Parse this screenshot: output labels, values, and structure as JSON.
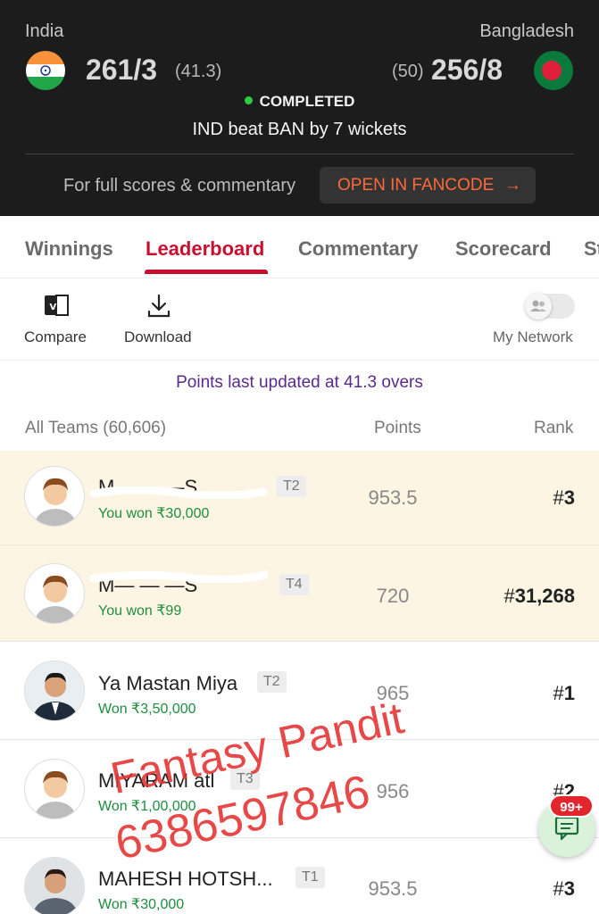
{
  "match": {
    "team1": {
      "name": "India",
      "score": "261/3",
      "overs": "(41.3)"
    },
    "team2": {
      "name": "Bangladesh",
      "score": "256/8",
      "overs": "(50)"
    },
    "status": "COMPLETED",
    "result": "IND beat BAN by 7 wickets",
    "full_scores_text": "For full scores & commentary",
    "open_button": "OPEN IN FANCODE",
    "status_color": "#2ecc40",
    "accent_color": "#ff6a3d"
  },
  "tabs": [
    {
      "label": "Winnings"
    },
    {
      "label": "Leaderboard"
    },
    {
      "label": "Commentary"
    },
    {
      "label": "Scorecard"
    },
    {
      "label": "St"
    }
  ],
  "active_tab": "Leaderboard",
  "toolbar": {
    "compare_label": "Compare",
    "compare_icon_text": "VS",
    "download_label": "Download",
    "network_label": "My Network",
    "network_toggle_on": false
  },
  "leaderboard": {
    "updated_text": "Points last updated at 41.3 overs",
    "all_teams": "All Teams (60,606)",
    "points_header": "Points",
    "rank_header": "Rank",
    "rows": [
      {
        "name": "M— — —S",
        "team": "T2",
        "won": "You won ₹30,000",
        "points": "953.5",
        "rank_prefix": "#",
        "rank": "3",
        "mine": true
      },
      {
        "name": "M— — —S",
        "team": "T4",
        "won": "You won ₹99",
        "points": "720",
        "rank_prefix": "#",
        "rank": "31,268",
        "mine": true
      },
      {
        "name": "Ya Mastan Miya",
        "team": "T2",
        "won": "Won ₹3,50,000",
        "points": "965",
        "rank_prefix": "#",
        "rank": "1",
        "mine": false
      },
      {
        "name": "MIYARAM atl",
        "team": "T3",
        "won": "Won ₹1,00,000",
        "points": "956",
        "rank_prefix": "#",
        "rank": "2",
        "mine": false
      },
      {
        "name": "MAHESH HOTSH...",
        "team": "T1",
        "won": "Won ₹30,000",
        "points": "953.5",
        "rank_prefix": "#",
        "rank": "3",
        "mine": false
      }
    ]
  },
  "watermark": {
    "line1": "Fantasy Pandit",
    "line2": "6386597846",
    "color": "#e43434"
  },
  "chat": {
    "badge": "99+"
  }
}
